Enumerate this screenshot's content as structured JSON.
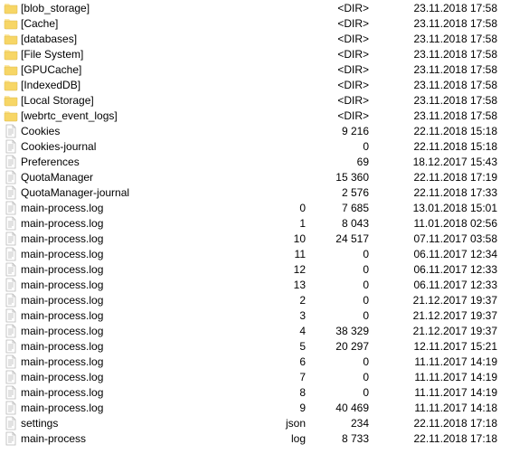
{
  "dir_marker": "<DIR>",
  "entries": [
    {
      "type": "dir",
      "name": "[blob_storage]",
      "ext": "",
      "size": "",
      "date": "23.11.2018 17:58"
    },
    {
      "type": "dir",
      "name": "[Cache]",
      "ext": "",
      "size": "",
      "date": "23.11.2018 17:58"
    },
    {
      "type": "dir",
      "name": "[databases]",
      "ext": "",
      "size": "",
      "date": "23.11.2018 17:58"
    },
    {
      "type": "dir",
      "name": "[File System]",
      "ext": "",
      "size": "",
      "date": "23.11.2018 17:58"
    },
    {
      "type": "dir",
      "name": "[GPUCache]",
      "ext": "",
      "size": "",
      "date": "23.11.2018 17:58"
    },
    {
      "type": "dir",
      "name": "[IndexedDB]",
      "ext": "",
      "size": "",
      "date": "23.11.2018 17:58"
    },
    {
      "type": "dir",
      "name": "[Local Storage]",
      "ext": "",
      "size": "",
      "date": "23.11.2018 17:58"
    },
    {
      "type": "dir",
      "name": "[webrtc_event_logs]",
      "ext": "",
      "size": "",
      "date": "23.11.2018 17:58"
    },
    {
      "type": "file",
      "name": "Cookies",
      "ext": "",
      "size": "9 216",
      "date": "22.11.2018 15:18"
    },
    {
      "type": "file",
      "name": "Cookies-journal",
      "ext": "",
      "size": "0",
      "date": "22.11.2018 15:18"
    },
    {
      "type": "file",
      "name": "Preferences",
      "ext": "",
      "size": "69",
      "date": "18.12.2017 15:43"
    },
    {
      "type": "file",
      "name": "QuotaManager",
      "ext": "",
      "size": "15 360",
      "date": "22.11.2018 17:19"
    },
    {
      "type": "file",
      "name": "QuotaManager-journal",
      "ext": "",
      "size": "2 576",
      "date": "22.11.2018 17:33"
    },
    {
      "type": "file",
      "name": "main-process.log",
      "ext": "0",
      "size": "7 685",
      "date": "13.01.2018 15:01"
    },
    {
      "type": "file",
      "name": "main-process.log",
      "ext": "1",
      "size": "8 043",
      "date": "11.01.2018 02:56"
    },
    {
      "type": "file",
      "name": "main-process.log",
      "ext": "10",
      "size": "24 517",
      "date": "07.11.2017 03:58"
    },
    {
      "type": "file",
      "name": "main-process.log",
      "ext": "11",
      "size": "0",
      "date": "06.11.2017 12:34"
    },
    {
      "type": "file",
      "name": "main-process.log",
      "ext": "12",
      "size": "0",
      "date": "06.11.2017 12:33"
    },
    {
      "type": "file",
      "name": "main-process.log",
      "ext": "13",
      "size": "0",
      "date": "06.11.2017 12:33"
    },
    {
      "type": "file",
      "name": "main-process.log",
      "ext": "2",
      "size": "0",
      "date": "21.12.2017 19:37"
    },
    {
      "type": "file",
      "name": "main-process.log",
      "ext": "3",
      "size": "0",
      "date": "21.12.2017 19:37"
    },
    {
      "type": "file",
      "name": "main-process.log",
      "ext": "4",
      "size": "38 329",
      "date": "21.12.2017 19:37"
    },
    {
      "type": "file",
      "name": "main-process.log",
      "ext": "5",
      "size": "20 297",
      "date": "12.11.2017 15:21"
    },
    {
      "type": "file",
      "name": "main-process.log",
      "ext": "6",
      "size": "0",
      "date": "11.11.2017 14:19"
    },
    {
      "type": "file",
      "name": "main-process.log",
      "ext": "7",
      "size": "0",
      "date": "11.11.2017 14:19"
    },
    {
      "type": "file",
      "name": "main-process.log",
      "ext": "8",
      "size": "0",
      "date": "11.11.2017 14:19"
    },
    {
      "type": "file",
      "name": "main-process.log",
      "ext": "9",
      "size": "40 469",
      "date": "11.11.2017 14:18"
    },
    {
      "type": "file",
      "name": "settings",
      "ext": "json",
      "size": "234",
      "date": "22.11.2018 17:18"
    },
    {
      "type": "file",
      "name": "main-process",
      "ext": "log",
      "size": "8 733",
      "date": "22.11.2018 17:18"
    }
  ]
}
